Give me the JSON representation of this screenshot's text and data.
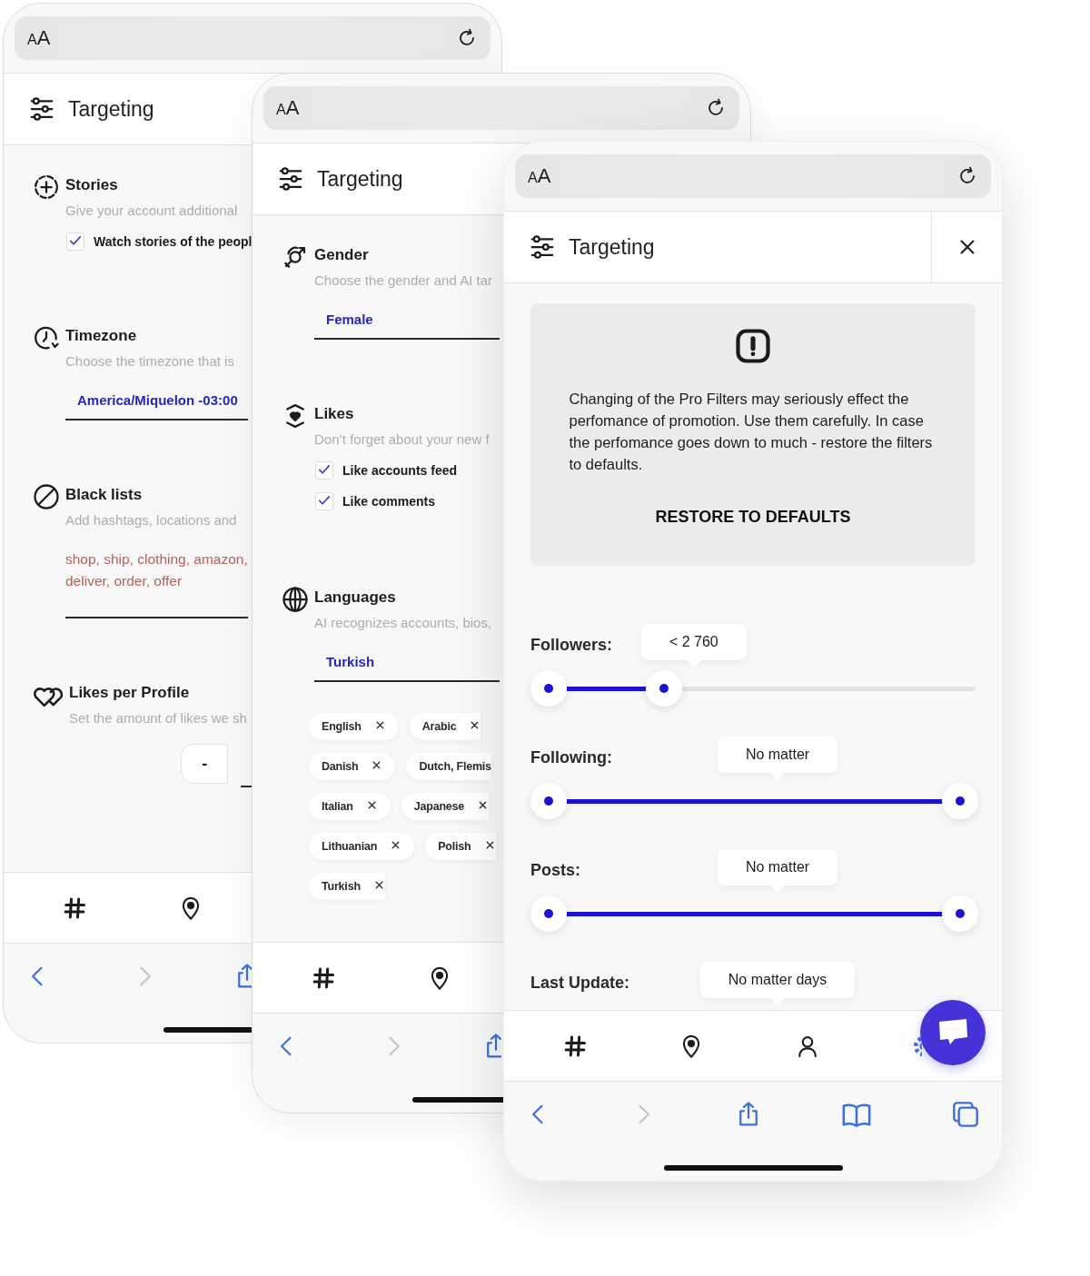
{
  "phones": [
    {
      "kind": "partial",
      "address_bar": {
        "label": "AA"
      },
      "header": {
        "title": "Targeting"
      },
      "sections": [
        {
          "title": "Stories",
          "description": "Give your account additional",
          "checks": [
            {
              "label": "Watch stories of the peopl",
              "checked": true
            }
          ]
        },
        {
          "title": "Timezone",
          "description": "Choose the timezone that is",
          "field": {
            "value": "America/Miquelon -03:00"
          }
        },
        {
          "title": "Black lists",
          "description": "Add hashtags, locations and",
          "list_field": {
            "lines": [
              "shop, ship, clothing, amazon,",
              "deliver, order, offer"
            ]
          }
        },
        {
          "title": "Likes per Profile",
          "description": "Set the amount of likes we sh",
          "stepper": {
            "minus": "-"
          }
        }
      ]
    },
    {
      "kind": "partial",
      "address_bar": {
        "label": "AA"
      },
      "header": {
        "title": "Targeting"
      },
      "sections": [
        {
          "title": "Gender",
          "description": "Choose the gender and AI tar",
          "field": {
            "value": "Female"
          }
        },
        {
          "title": "Likes",
          "description": "Don’t forget about your new f",
          "checks": [
            {
              "label": "Like accounts feed",
              "checked": true
            },
            {
              "label": "Like comments",
              "checked": true
            }
          ]
        },
        {
          "title": "Languages",
          "description": "AI recognizes accounts, bios,",
          "field": {
            "value": "Turkish"
          },
          "chip_rows": [
            [
              {
                "label": "English"
              },
              {
                "label": "Arabic"
              }
            ],
            [
              {
                "label": "Danish"
              },
              {
                "label": "Dutch, Flemis",
                "removable": false
              }
            ],
            [
              {
                "label": "Italian"
              },
              {
                "label": "Japanese"
              }
            ],
            [
              {
                "label": "Lithuanian"
              },
              {
                "label": "Polish"
              }
            ],
            [
              {
                "label": "Turkish"
              }
            ]
          ]
        }
      ]
    },
    {
      "kind": "full",
      "address_bar": {
        "label": "AA"
      },
      "header": {
        "title": "Targeting"
      },
      "warning": {
        "message": "Changing of the Pro Filters may seriously effect the perfomance of promotion. Use them carefully. In case the perfomance goes down to much - restore the filters to defaults.",
        "action": "RESTORE TO DEFAULTS"
      },
      "filters": [
        {
          "label": "Followers:",
          "tooltip": "< 2 760",
          "level": 0.28
        },
        {
          "label": "Following:",
          "tooltip": "No matter",
          "level": 1
        },
        {
          "label": "Posts:",
          "tooltip": "No matter",
          "level": 1
        },
        {
          "label": "Last Update:",
          "tooltip": "No matter days"
        }
      ]
    }
  ]
}
